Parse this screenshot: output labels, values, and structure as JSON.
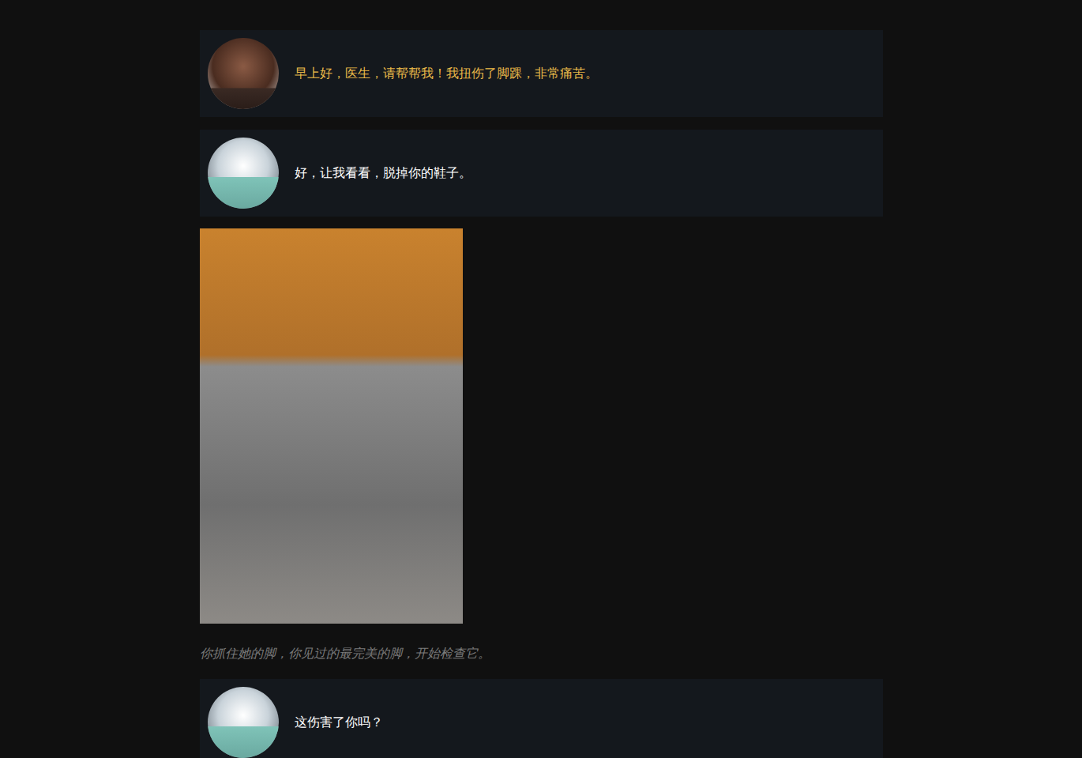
{
  "chat": {
    "items": [
      {
        "kind": "message",
        "speaker": "patient",
        "text": "早上好，医生，请帮帮我！我扭伤了脚踝，非常痛苦。",
        "color": "#e9b949"
      },
      {
        "kind": "message",
        "speaker": "doctor",
        "text": "好，让我看看，脱掉你的鞋子。",
        "color": "#ffffff"
      },
      {
        "kind": "image"
      },
      {
        "kind": "narration",
        "text": "你抓住她的脚，你见过的最完美的脚，开始检查它。"
      },
      {
        "kind": "message",
        "speaker": "doctor",
        "text": "这伤害了你吗？",
        "color": "#ffffff"
      }
    ]
  }
}
